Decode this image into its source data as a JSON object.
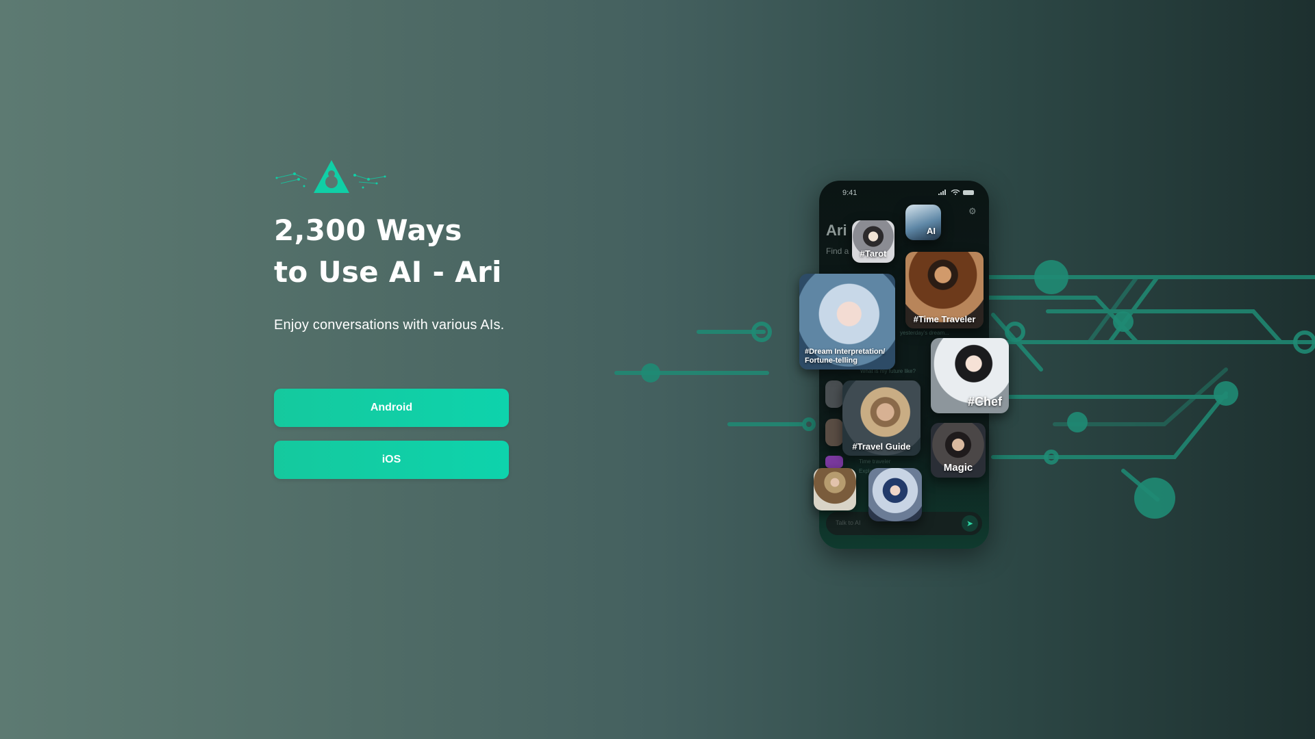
{
  "hero": {
    "title_line1": "2,300 Ways",
    "title_line2": "to Use AI - Ari",
    "subtitle": "Enjoy conversations with various AIs.",
    "android_label": "Android",
    "ios_label": "iOS"
  },
  "phone": {
    "status_time": "9:41",
    "app_name": "Ari",
    "find_text": "Find a",
    "chat_placeholder": "Talk to AI",
    "faint_texts": [
      "yesterday's dream...",
      "What is my future like?",
      "Time traveler",
      "Explore the future"
    ],
    "cards": {
      "tarot": "#Tarot",
      "ai": "AI",
      "time_traveler": "#Time Traveler",
      "dream": "#Dream Interpretation/ Fortune-telling",
      "chef": "#Chef",
      "travel_guide": "#Travel Guide",
      "magic": "Magic"
    }
  },
  "colors": {
    "accent": "#10cfa6",
    "circuit": "#1f8b74"
  },
  "icons": {
    "logo": "ari-logo-icon",
    "gear": "gear-icon",
    "send": "send-icon",
    "signal": "signal-icon",
    "wifi": "wifi-icon",
    "battery": "battery-icon"
  }
}
